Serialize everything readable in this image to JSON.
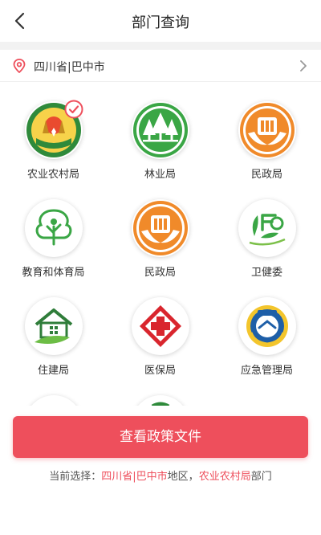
{
  "header": {
    "title": "部门查询",
    "back_icon": "chevron-left-icon"
  },
  "location": {
    "text": "四川省|巴中市",
    "pin_icon": "location-pin-icon",
    "arrow_icon": "chevron-right-icon"
  },
  "departments": [
    {
      "label": "农业农村局",
      "icon": "agriculture-emblem-icon",
      "selected": true
    },
    {
      "label": "林业局",
      "icon": "forestry-trees-icon",
      "selected": false
    },
    {
      "label": "民政局",
      "icon": "civil-affairs-emblem-icon",
      "selected": false
    },
    {
      "label": "教育和体育局",
      "icon": "education-tree-icon",
      "selected": false
    },
    {
      "label": "民政局",
      "icon": "civil-affairs-emblem-icon",
      "selected": false
    },
    {
      "label": "卫健委",
      "icon": "health-commission-icon",
      "selected": false
    },
    {
      "label": "住建局",
      "icon": "housing-house-icon",
      "selected": false
    },
    {
      "label": "医保局",
      "icon": "medical-insurance-cross-icon",
      "selected": false
    },
    {
      "label": "应急管理局",
      "icon": "emergency-management-emblem-icon",
      "selected": false
    }
  ],
  "action_button": {
    "label": "查看政策文件"
  },
  "status": {
    "prefix": "当前选择：",
    "region": "四川省|巴中市",
    "region_suffix": "地区，",
    "department": "农业农村局",
    "department_suffix": "部门"
  },
  "colors": {
    "accent": "#ee4f5c",
    "orange": "#f08a2a",
    "green": "#3aa645"
  }
}
